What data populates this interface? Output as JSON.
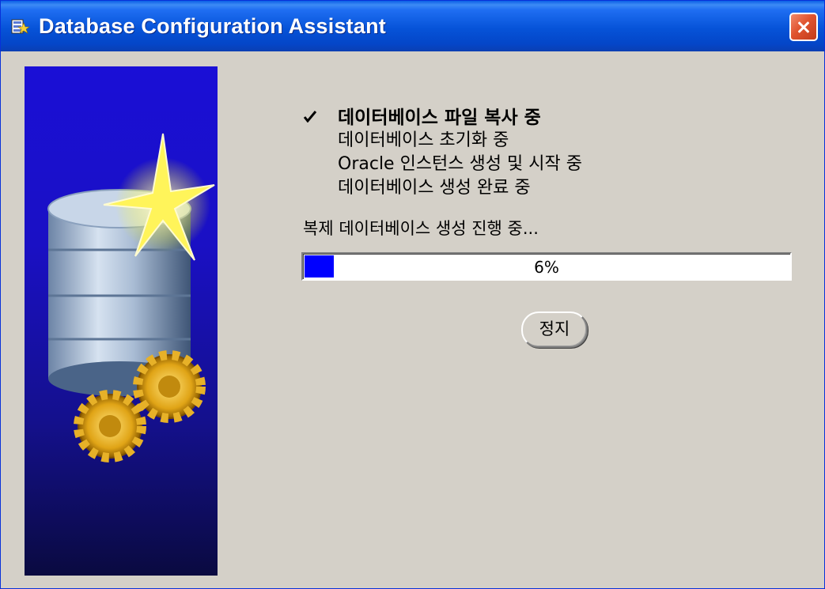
{
  "window": {
    "title": "Database Configuration Assistant"
  },
  "steps": [
    {
      "label": "데이터베이스 파일 복사 중",
      "done": true
    },
    {
      "label": "데이터베이스 초기화 중",
      "done": false
    },
    {
      "label": "Oracle 인스턴스 생성 및 시작 중",
      "done": false
    },
    {
      "label": "데이터베이스 생성 완료 중",
      "done": false
    }
  ],
  "status": {
    "message": "복제 데이터베이스 생성 진행 중..."
  },
  "progress": {
    "value": 6,
    "label": "6%",
    "fill_color": "#0000ff"
  },
  "buttons": {
    "stop_label": "정지"
  },
  "icons": {
    "title_icon": "database-icon",
    "close_icon": "close-icon",
    "check_icon": "checkmark-icon"
  },
  "colors": {
    "titlebar": "#0653d8",
    "dialog_bg": "#d4d0c8",
    "close_button": "#e0542f"
  }
}
